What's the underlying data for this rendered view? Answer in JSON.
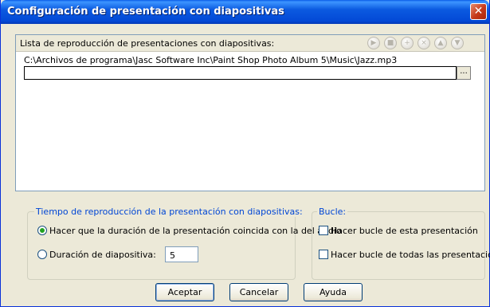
{
  "window": {
    "title": "Configuración de presentación con diapositivas",
    "close_glyph": "✕"
  },
  "playlist": {
    "header_label": "Lista de reproducción de presentaciones con diapositivas:",
    "toolbar_icons": [
      "play-icon",
      "stop-icon",
      "add-icon",
      "remove-icon",
      "move-up-icon",
      "move-down-icon"
    ],
    "items": [
      "C:\\Archivos de programa\\Jasc Software Inc\\Paint Shop Photo Album 5\\Music\\Jazz.mp3"
    ],
    "path_value": "",
    "browse_label": "..."
  },
  "timing": {
    "legend": "Tiempo de reproducción de la presentación con diapositivas:",
    "option_audio_label": "Hacer que la duración de la presentación coincida con la del audio",
    "option_audio_checked": true,
    "option_slide_label": "Duración de diapositiva:",
    "option_slide_checked": false,
    "slide_duration": "5"
  },
  "loop": {
    "legend": "Bucle:",
    "loop_this_label": "Hacer bucle de esta presentación",
    "loop_this_checked": false,
    "loop_all_label": "Hacer bucle de todas las presentaciones",
    "loop_all_checked": false
  },
  "buttons": {
    "ok": "Aceptar",
    "cancel": "Cancelar",
    "help": "Ayuda"
  },
  "colors": {
    "titlebar": "#0a5ee8",
    "dialog_bg": "#ece9d8",
    "group_legend": "#0046d5"
  }
}
